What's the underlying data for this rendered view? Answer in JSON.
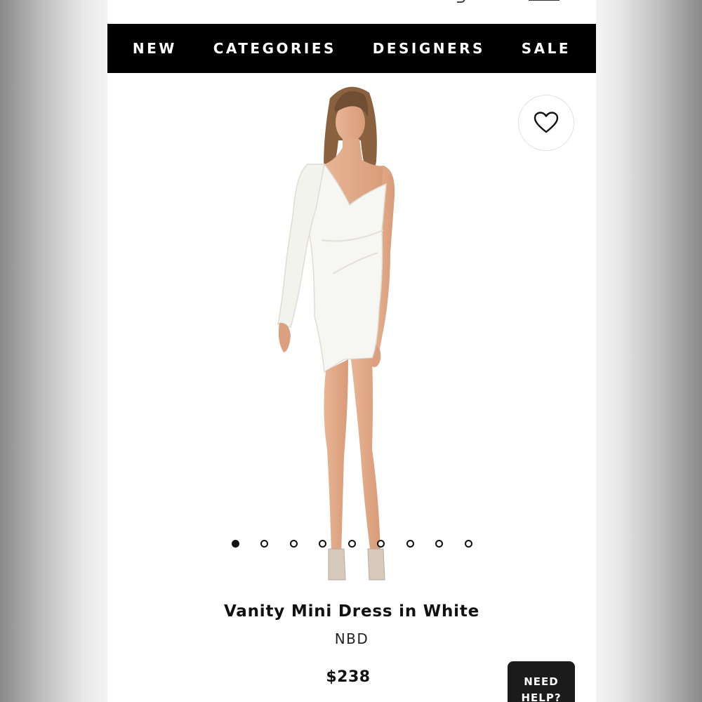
{
  "nav": {
    "items": [
      {
        "label": "NEW"
      },
      {
        "label": "CATEGORIES"
      },
      {
        "label": "DESIGNERS"
      },
      {
        "label": "SALE"
      }
    ]
  },
  "gallery": {
    "favorite_icon": "heart-icon",
    "image_count": 9,
    "active_index": 0
  },
  "product": {
    "title": "Vanity Mini Dress in White",
    "brand": "NBD",
    "price": "$238"
  },
  "help": {
    "label_line1": "NEED",
    "label_line2": "HELP?"
  },
  "colors": {
    "nav_bg": "#000000",
    "help_bg": "#1b1b1b"
  }
}
